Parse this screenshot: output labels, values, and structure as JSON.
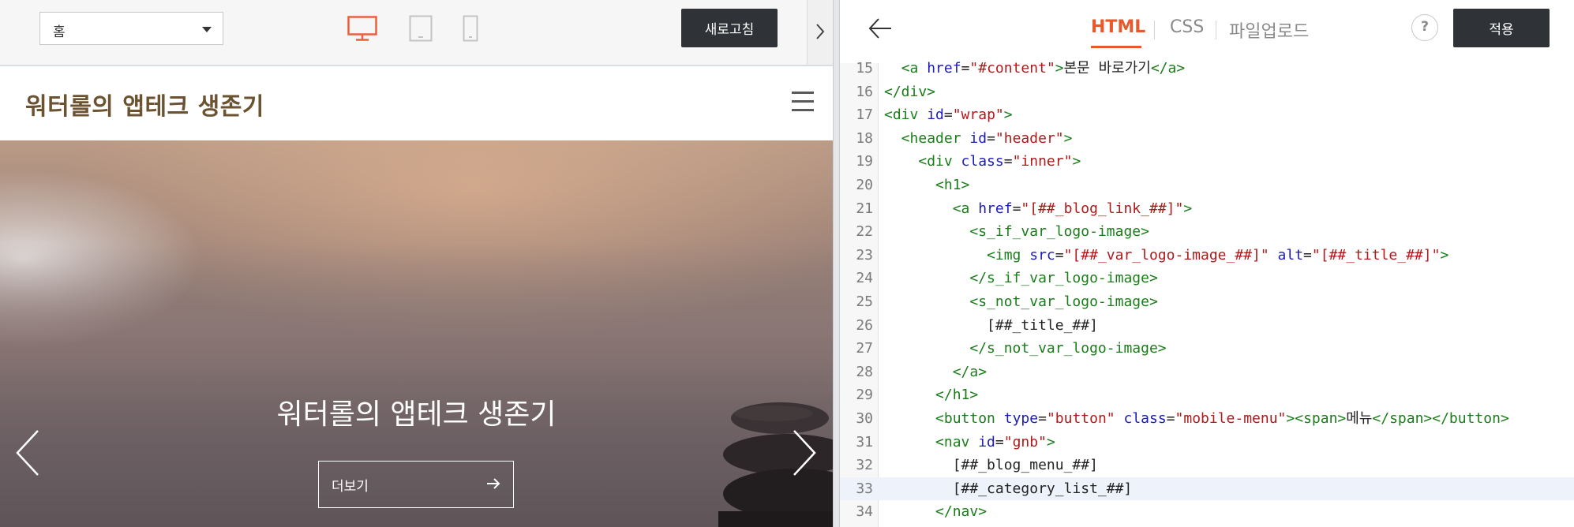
{
  "left_toolbar": {
    "page_select_value": "홈",
    "device_desktop": "desktop-icon",
    "device_tablet": "tablet-icon",
    "device_mobile": "mobile-icon",
    "refresh_label": "새로고침",
    "collapse_icon": "chevron-right-icon"
  },
  "blog": {
    "title": "워터롤의 앱테크 생존기",
    "hero_title": "워터롤의 앱테크 생존기",
    "more_label": "더보기"
  },
  "editor_toolbar": {
    "tabs": [
      "HTML",
      "CSS",
      "파일업로드"
    ],
    "active_tab": "HTML",
    "help_label": "?",
    "apply_label": "적용"
  },
  "colors": {
    "accent": "#e85a2c",
    "dark_button": "#2f3236",
    "blog_title": "#6b5230"
  },
  "code": {
    "active_line": 33,
    "lines": [
      {
        "n": "15",
        "parts": [
          [
            "x",
            "  "
          ],
          [
            "t",
            "<a "
          ],
          [
            "a",
            "href"
          ],
          [
            "x",
            "="
          ],
          [
            "s",
            "\"#content\""
          ],
          [
            "t",
            ">"
          ],
          [
            "x",
            "본문 바로가기"
          ],
          [
            "t",
            "</a>"
          ]
        ]
      },
      {
        "n": "16",
        "parts": [
          [
            "t",
            "</div>"
          ]
        ]
      },
      {
        "n": "17",
        "parts": [
          [
            "t",
            "<div "
          ],
          [
            "a",
            "id"
          ],
          [
            "x",
            "="
          ],
          [
            "s",
            "\"wrap\""
          ],
          [
            "t",
            ">"
          ]
        ]
      },
      {
        "n": "18",
        "parts": [
          [
            "x",
            "  "
          ],
          [
            "t",
            "<header "
          ],
          [
            "a",
            "id"
          ],
          [
            "x",
            "="
          ],
          [
            "s",
            "\"header\""
          ],
          [
            "t",
            ">"
          ]
        ]
      },
      {
        "n": "19",
        "parts": [
          [
            "x",
            "    "
          ],
          [
            "t",
            "<div "
          ],
          [
            "a",
            "class"
          ],
          [
            "x",
            "="
          ],
          [
            "s",
            "\"inner\""
          ],
          [
            "t",
            ">"
          ]
        ]
      },
      {
        "n": "20",
        "parts": [
          [
            "x",
            "      "
          ],
          [
            "t",
            "<h1>"
          ]
        ]
      },
      {
        "n": "21",
        "parts": [
          [
            "x",
            "        "
          ],
          [
            "t",
            "<a "
          ],
          [
            "a",
            "href"
          ],
          [
            "x",
            "="
          ],
          [
            "s",
            "\"[##_blog_link_##]\""
          ],
          [
            "t",
            ">"
          ]
        ]
      },
      {
        "n": "22",
        "parts": [
          [
            "x",
            "          "
          ],
          [
            "t",
            "<s_if_var_logo-image>"
          ]
        ]
      },
      {
        "n": "23",
        "parts": [
          [
            "x",
            "            "
          ],
          [
            "t",
            "<img "
          ],
          [
            "a",
            "src"
          ],
          [
            "x",
            "="
          ],
          [
            "s",
            "\"[##_var_logo-image_##]\""
          ],
          [
            "x",
            " "
          ],
          [
            "a",
            "alt"
          ],
          [
            "x",
            "="
          ],
          [
            "s",
            "\"[##_title_##]\""
          ],
          [
            "t",
            ">"
          ]
        ]
      },
      {
        "n": "24",
        "parts": [
          [
            "x",
            "          "
          ],
          [
            "t",
            "</s_if_var_logo-image>"
          ]
        ]
      },
      {
        "n": "25",
        "parts": [
          [
            "x",
            "          "
          ],
          [
            "t",
            "<s_not_var_logo-image>"
          ]
        ]
      },
      {
        "n": "26",
        "parts": [
          [
            "x",
            "            [##_title_##]"
          ]
        ]
      },
      {
        "n": "27",
        "parts": [
          [
            "x",
            "          "
          ],
          [
            "t",
            "</s_not_var_logo-image>"
          ]
        ]
      },
      {
        "n": "28",
        "parts": [
          [
            "x",
            "        "
          ],
          [
            "t",
            "</a>"
          ]
        ]
      },
      {
        "n": "29",
        "parts": [
          [
            "x",
            "      "
          ],
          [
            "t",
            "</h1>"
          ]
        ]
      },
      {
        "n": "30",
        "parts": [
          [
            "x",
            "      "
          ],
          [
            "t",
            "<button "
          ],
          [
            "a",
            "type"
          ],
          [
            "x",
            "="
          ],
          [
            "s",
            "\"button\""
          ],
          [
            "x",
            " "
          ],
          [
            "a",
            "class"
          ],
          [
            "x",
            "="
          ],
          [
            "s",
            "\"mobile-menu\""
          ],
          [
            "t",
            "><span>"
          ],
          [
            "x",
            "메뉴"
          ],
          [
            "t",
            "</span></button>"
          ]
        ]
      },
      {
        "n": "31",
        "parts": [
          [
            "x",
            "      "
          ],
          [
            "t",
            "<nav "
          ],
          [
            "a",
            "id"
          ],
          [
            "x",
            "="
          ],
          [
            "s",
            "\"gnb\""
          ],
          [
            "t",
            ">"
          ]
        ]
      },
      {
        "n": "32",
        "parts": [
          [
            "x",
            "        [##_blog_menu_##]"
          ]
        ]
      },
      {
        "n": "33",
        "parts": [
          [
            "x",
            "        [##_category_list_##]"
          ]
        ]
      },
      {
        "n": "34",
        "parts": [
          [
            "x",
            "      "
          ],
          [
            "t",
            "</nav>"
          ]
        ]
      }
    ]
  }
}
